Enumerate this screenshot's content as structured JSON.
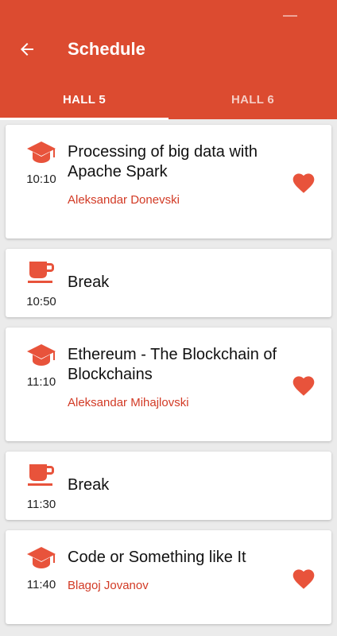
{
  "colors": {
    "primary": "#dc4b30",
    "accent": "#e8533b",
    "speaker": "#d23a25"
  },
  "header": {
    "title": "Schedule",
    "back_icon": "arrow-back-icon"
  },
  "tabs": [
    {
      "label": "HALL 5",
      "active": true
    },
    {
      "label": "HALL 6",
      "active": false
    }
  ],
  "sessions": [
    {
      "type": "talk",
      "icon": "graduation-cap-icon",
      "time": "10:10",
      "title": "Processing of big data with Apache Spark",
      "speaker": "Aleksandar Donevski",
      "favorite": true
    },
    {
      "type": "break",
      "icon": "coffee-cup-icon",
      "time": "10:50",
      "title": "Break"
    },
    {
      "type": "talk",
      "icon": "graduation-cap-icon",
      "time": "11:10",
      "title": "Ethereum - The Blockchain of Blockchains",
      "speaker": "Aleksandar Mihajlovski",
      "favorite": true
    },
    {
      "type": "break",
      "icon": "coffee-cup-icon",
      "time": "11:30",
      "title": "Break"
    },
    {
      "type": "talk",
      "icon": "graduation-cap-icon",
      "time": "11:40",
      "title": "Code or Something like It",
      "speaker": "Blagoj Jovanov",
      "favorite": true
    }
  ]
}
